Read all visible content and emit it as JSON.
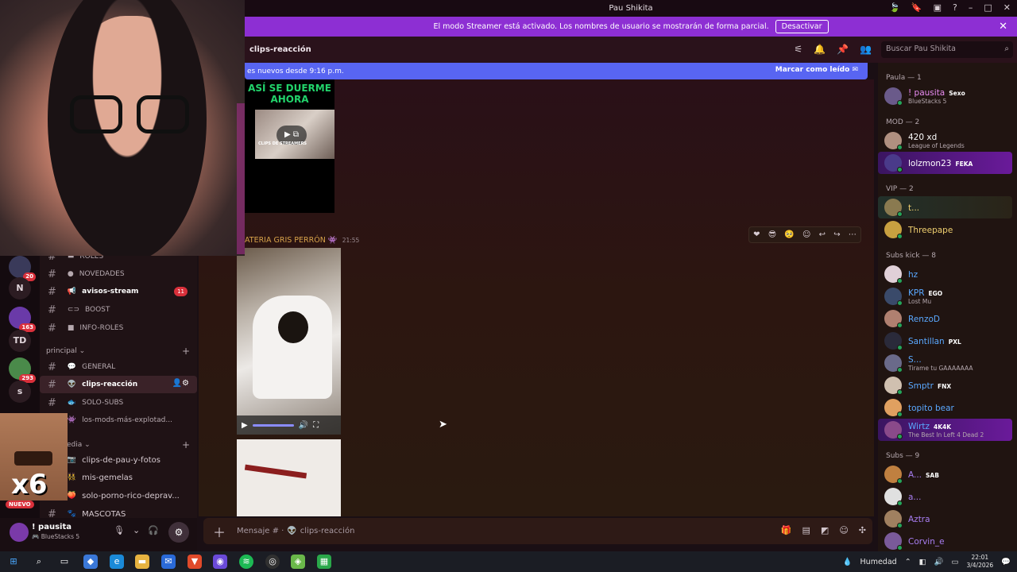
{
  "window": {
    "title": "Pau Shikita"
  },
  "banner": {
    "text": "El modo Streamer está activado. Los nombres de usuario se mostrarán de forma parcial.",
    "button": "Desactivar"
  },
  "channel_header": {
    "name": "clips-reacción"
  },
  "search": {
    "placeholder": "Buscar Pau Shikita"
  },
  "new_messages": {
    "text": "es nuevos desde 9:16 p.m.",
    "mark_read": "Marcar como leído"
  },
  "messages": {
    "video1_title": "ASÍ SE DUERME AHORA",
    "video1_tag": "CLIPS DE STREAMERS",
    "author": "ATERIA GRIS PERRÓN",
    "time": "21:55"
  },
  "composer": {
    "placeholder": "Mensaje # · ",
    "channel": "clips-reacción"
  },
  "members": {
    "groups": [
      {
        "title": "Paula — 1",
        "items": [
          {
            "name": "! pausita",
            "badge": "Sexo",
            "status": "BlueStacks 5",
            "color": "#e98cf2"
          }
        ]
      },
      {
        "title": "MOD — 2",
        "items": [
          {
            "name": "420 xd",
            "status": "League of Legends",
            "color": "#ffffff"
          },
          {
            "name": "lolzmon23",
            "badge": "FEKA",
            "status": "",
            "color": "#ffffff"
          }
        ]
      },
      {
        "title": "VIP — 2",
        "items": [
          {
            "name": "t...",
            "status": "",
            "color": "#f0d070"
          },
          {
            "name": "Threepape",
            "status": "",
            "color": "#f0d070"
          }
        ]
      },
      {
        "title": "Subs kick — 8",
        "items": [
          {
            "name": "hz",
            "status": "",
            "color": "#5aa8ff"
          },
          {
            "name": "KPR",
            "badge": "EGO",
            "status": "Lost Mu",
            "color": "#5aa8ff"
          },
          {
            "name": "RenzoD",
            "status": "",
            "color": "#5aa8ff"
          },
          {
            "name": "Santillan",
            "badge": "PXL",
            "status": "",
            "color": "#5aa8ff"
          },
          {
            "name": "S...",
            "status": "Tirame tu GAAAAAAA",
            "color": "#5aa8ff"
          },
          {
            "name": "Smptr",
            "badge": "FNX",
            "status": "",
            "color": "#5aa8ff"
          },
          {
            "name": "topito bear",
            "status": "",
            "color": "#5aa8ff"
          },
          {
            "name": "Wirtz",
            "badge": "4K4K",
            "status": "The Best In Left 4 Dead 2",
            "color": "#5aa8ff"
          }
        ]
      },
      {
        "title": "Subs — 9",
        "items": [
          {
            "name": "A...",
            "badge": "SAB",
            "status": "",
            "color": "#a87ef2"
          },
          {
            "name": "a...",
            "status": "",
            "color": "#a87ef2"
          },
          {
            "name": "Aztra",
            "status": "",
            "color": "#a87ef2"
          },
          {
            "name": "Corvin_e",
            "status": "",
            "color": "#a87ef2"
          }
        ]
      }
    ]
  },
  "servers": [
    {
      "label": "",
      "badge": "20"
    },
    {
      "label": "N",
      "badge": ""
    },
    {
      "label": "",
      "badge": "163"
    },
    {
      "label": "TD",
      "badge": ""
    },
    {
      "label": "",
      "badge": "293"
    },
    {
      "label": "s",
      "badge": ""
    }
  ],
  "channels": {
    "top": [
      {
        "name": "ROLES"
      },
      {
        "name": "NOVEDADES"
      },
      {
        "name": "avisos-stream",
        "count": "11"
      },
      {
        "name": "BOOST"
      },
      {
        "name": "INFO-ROLES"
      }
    ],
    "cat_principal": "principal",
    "principal": [
      {
        "name": "GENERAL"
      },
      {
        "name": "clips-reacción"
      },
      {
        "name": "SOLO-SUBS"
      },
      {
        "name": "los-mods-más-explotad..."
      }
    ],
    "cat_media": "edia",
    "media": [
      {
        "name": "clips-de-pau-y-fotos"
      },
      {
        "name": "mis-gemelas"
      },
      {
        "name": "solo-porno-rico-deprav..."
      },
      {
        "name": "MASCOTAS"
      }
    ]
  },
  "meme": {
    "text": "x6",
    "badge": "NUEVO"
  },
  "user": {
    "name": "! pausita",
    "status": "BlueStacks 5"
  },
  "taskbar": {
    "weather": "Humedad",
    "time": "22:01",
    "date": "3/4/2026"
  }
}
